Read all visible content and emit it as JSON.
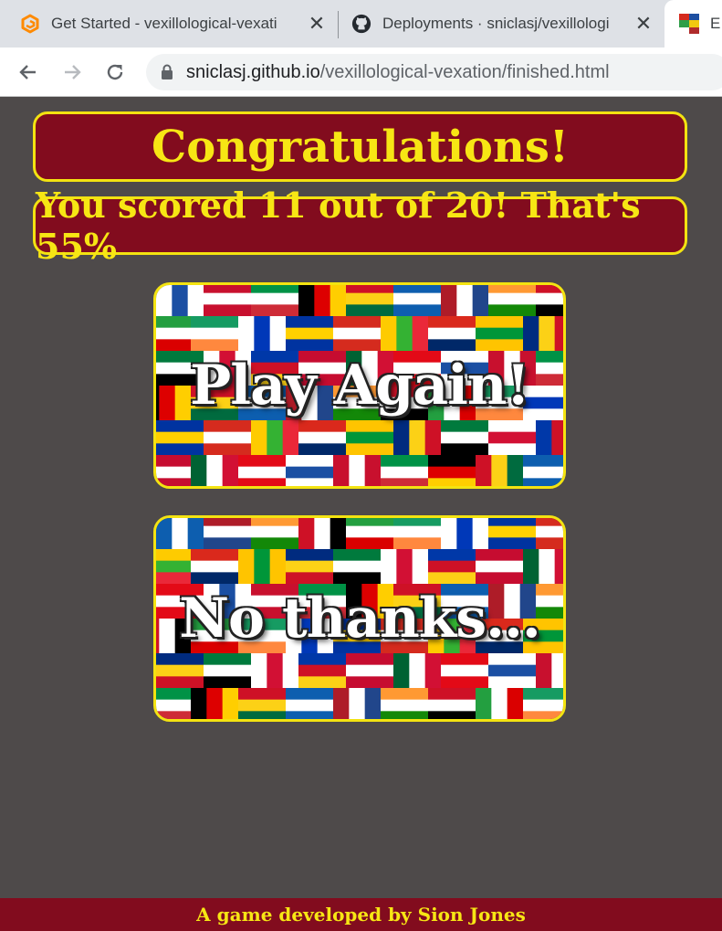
{
  "browser": {
    "tabs": [
      {
        "title": "Get Started - vexillological-vexati",
        "icon": "gitpod-icon"
      },
      {
        "title": "Deployments · sniclasj/vexillologi",
        "icon": "github-icon"
      },
      {
        "title": "E",
        "icon": "flags-favicon"
      }
    ],
    "url_host": "sniclasj.github.io",
    "url_path": "/vexillological-vexation/finished.html"
  },
  "page": {
    "heading": "Congratulations!",
    "score_text": "You scored 11 out of 20! That's 55%",
    "play_again_label": "Play Again!",
    "no_thanks_label": "No thanks...",
    "footer_text": "A game developed by Sion Jones"
  },
  "colors": {
    "background": "#4e4a4a",
    "banner": "#820c1e",
    "accent": "#f7e614"
  }
}
